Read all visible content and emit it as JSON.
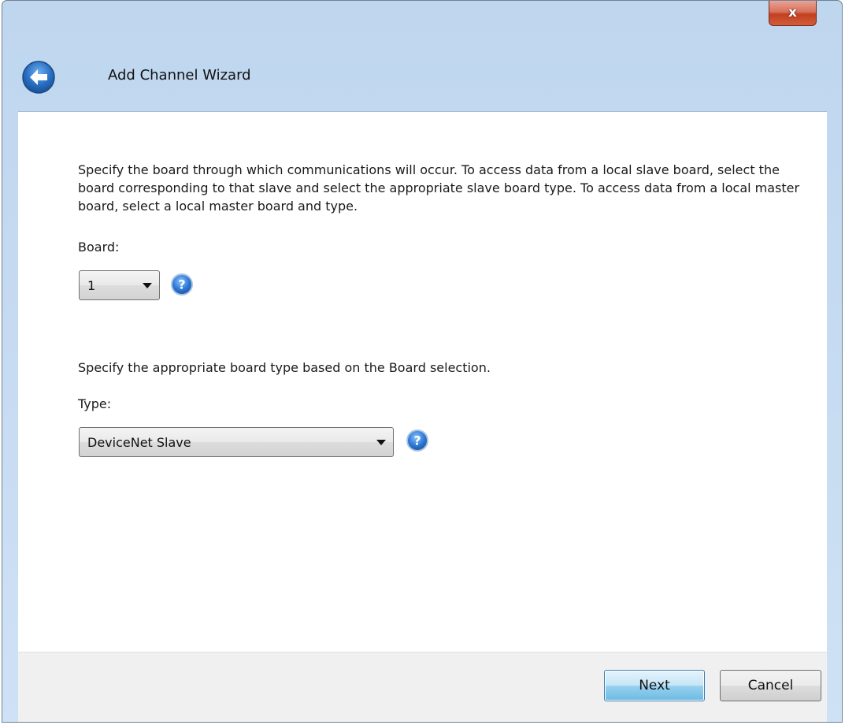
{
  "window": {
    "title": "Add Channel Wizard",
    "close_label": "x"
  },
  "content": {
    "board_description": "Specify the board through which communications will occur. To access data from a local slave board, select the board corresponding to that slave and select the appropriate slave board type. To access data from a local master board, select a local master board and type.",
    "board_label": "Board:",
    "board_value": "1",
    "type_description": "Specify the appropriate board type based on the Board selection.",
    "type_label": "Type:",
    "type_value": "DeviceNet Slave"
  },
  "footer": {
    "next_label": "Next",
    "cancel_label": "Cancel"
  },
  "icons": {
    "back": "back-arrow-icon",
    "help": "help-question-icon",
    "close": "close-x-icon",
    "dropdown": "chevron-down-icon"
  },
  "colors": {
    "title_bar": "#c7dcf2",
    "close_button": "#c2401f",
    "back_button": "#2a6fc2",
    "help_icon": "#2f7ad6",
    "default_button": "#98d1ef"
  }
}
